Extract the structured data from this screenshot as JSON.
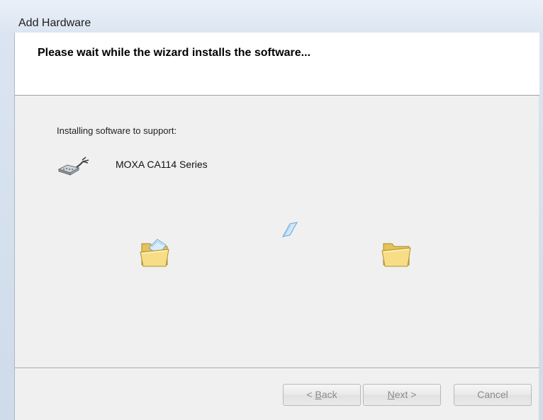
{
  "window": {
    "title": "Add Hardware"
  },
  "header": {
    "title": "Please wait while the wizard installs the software..."
  },
  "content": {
    "install_label": "Installing software to support:",
    "device_name": "MOXA CA114 Series",
    "device_icon": "serial-port-icon",
    "source_icon": "open-folder-icon",
    "transfer_icon": "flying-paper-icon",
    "destination_icon": "folder-icon"
  },
  "buttons": {
    "back": {
      "prefix": "< ",
      "accel": "B",
      "rest": "ack"
    },
    "next": {
      "accel": "N",
      "rest": "ext >"
    },
    "cancel": "Cancel"
  },
  "colors": {
    "folder": "#f4d77a",
    "paper": "#a9d3f2"
  }
}
